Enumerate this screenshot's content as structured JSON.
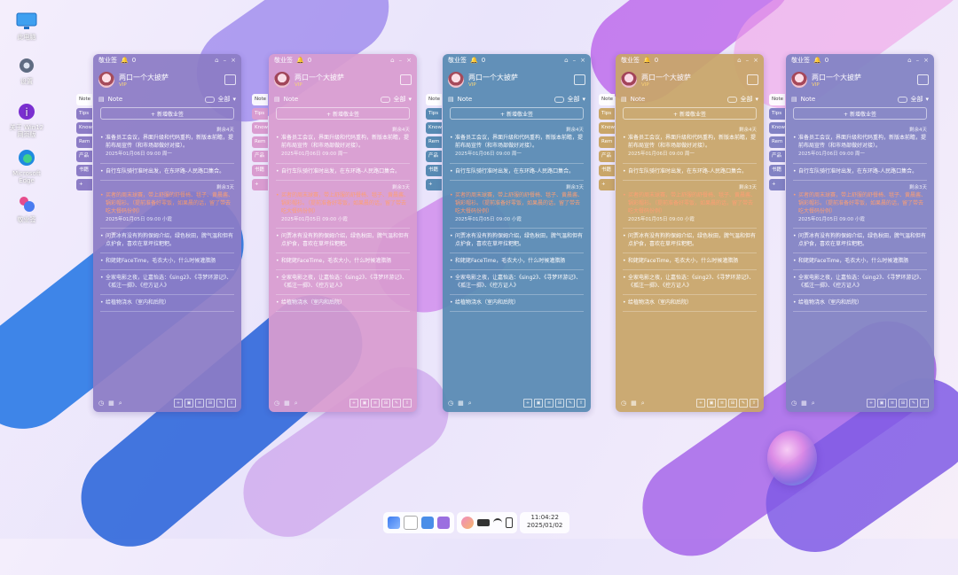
{
  "desktop_icons": [
    {
      "label": "此电脑",
      "icon": "monitor-icon"
    },
    {
      "label": "设置",
      "icon": "gear-icon"
    },
    {
      "label": "关于 Win12 网页版",
      "icon": "info-icon"
    },
    {
      "label": "Microsoft Edge",
      "icon": "edge-icon"
    },
    {
      "label": "敬业签",
      "icon": "app-icon"
    }
  ],
  "widget": {
    "app_name": "敬业签",
    "bell_count": "0",
    "username": "两口一个大披萨",
    "vip": "VIP",
    "tab_note": "Note",
    "filter_all": "全部",
    "add_label": "+ 新增敬业签",
    "notes": [
      {
        "remaining": "剩余4天",
        "text": "准备员工会议，界面升级和代码重构，新版本前瞻，提前布局宣传（和市场部做好对接）。",
        "meta": "2025年01月06日 09:00 周一",
        "orange": false
      },
      {
        "remaining": "",
        "text": "自行车队骑行准时出发，在东环路-人民路口集合。",
        "meta": "",
        "orange": false
      },
      {
        "remaining": "剩余3天",
        "text": "买者的周末球赛，带上舒服的舒餐椅、毯子、黄晨酱、锅彩帽衫。（提前准备好零饭，如果晨的话，留了带去吃大餐码份例）",
        "meta": "2025年01月05日 09:00 小霞",
        "orange": true
      },
      {
        "remaining": "",
        "text": "问贾冰有没有狗狗保姆介绍，绿色秋田，脾气温和但有点护食，喜欢在草坪拉粑粑。",
        "meta": "",
        "orange": false
      },
      {
        "remaining": "",
        "text": "和姥姥FaceTime，毛衣大小，什么时候灌腊肠",
        "meta": "",
        "orange": false
      },
      {
        "remaining": "",
        "text": "全家电影之夜，让嘉怡选：《sing2》、《寻梦环游记》、《孤注一掷》、《控方证人》",
        "meta": "",
        "orange": false
      },
      {
        "remaining": "",
        "text": "给植物浇水（室内和后院）",
        "meta": "",
        "orange": false
      }
    ],
    "side_tabs": [
      "Note",
      "Tips",
      "Know",
      "Rem",
      "产品",
      "书籍",
      "+"
    ]
  },
  "taskbar": {
    "time": "11:04:22",
    "date": "2025/01/02"
  },
  "colors": {
    "lavender": "#8c7cc6",
    "pink": "#d99cd0",
    "teal": "#588ab3",
    "amber": "#c9a669",
    "indigo": "#8282c4"
  }
}
